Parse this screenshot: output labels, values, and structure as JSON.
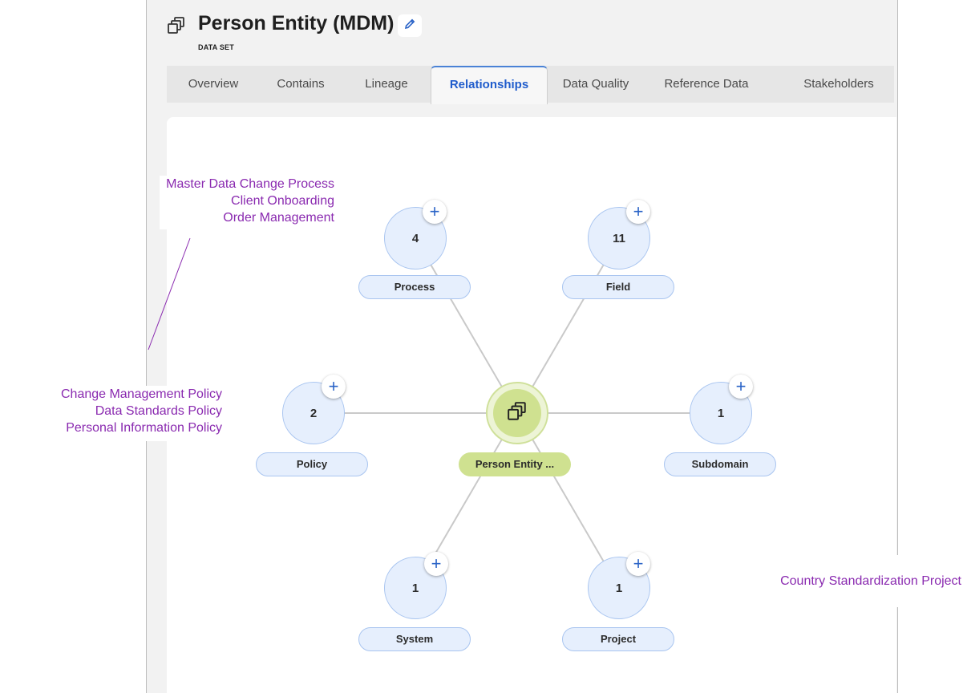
{
  "header": {
    "title": "Person Entity (MDM)",
    "subtitle": "DATA SET",
    "entity_icon": "entity-stack-icon",
    "edit_icon": "pencil-icon"
  },
  "tabs": [
    {
      "label": "Overview",
      "active": false
    },
    {
      "label": "Contains",
      "active": false
    },
    {
      "label": "Lineage",
      "active": false
    },
    {
      "label": "Relationships",
      "active": true
    },
    {
      "label": "Data Quality",
      "active": false
    },
    {
      "label": "Reference Data",
      "active": false
    },
    {
      "label": "Stakeholders",
      "active": false
    }
  ],
  "graph": {
    "center": {
      "label": "Person Entity ...",
      "icon": "entity-stack-icon"
    },
    "nodes": [
      {
        "label": "Process",
        "count": "4"
      },
      {
        "label": "Field",
        "count": "11"
      },
      {
        "label": "Policy",
        "count": "2"
      },
      {
        "label": "Subdomain",
        "count": "1"
      },
      {
        "label": "System",
        "count": "1"
      },
      {
        "label": "Project",
        "count": "1"
      }
    ],
    "add_icon": "plus-icon"
  },
  "callouts": {
    "process": [
      "Master Data Change Process",
      "Client Onboarding",
      "Order Management"
    ],
    "policy": [
      "Change Management Policy",
      "Data Standards Policy",
      "Personal Information Policy"
    ],
    "project": [
      "Country Standardization Project"
    ]
  },
  "colors": {
    "accent": "#1f5ccc",
    "node_fill": "#e6effd",
    "node_border": "#a9c5f0",
    "center_fill": "#cfe190",
    "callout": "#8a2ab0"
  }
}
